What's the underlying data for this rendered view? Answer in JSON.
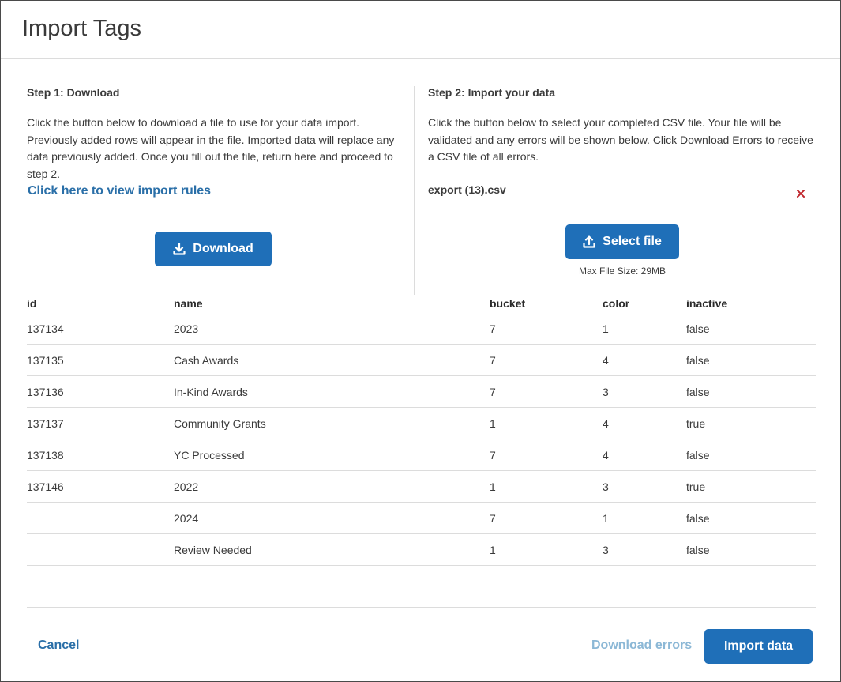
{
  "dialog": {
    "title": "Import Tags"
  },
  "step1": {
    "title": "Step 1: Download",
    "description": "Click the button below to download a file to use for your data import. Previously added rows will appear in the file. Imported data will replace any data previously added. Once you fill out the file, return here and proceed to step 2.",
    "rules_link": "Click here to view import rules",
    "download_label": "Download",
    "download_icon": "download-icon"
  },
  "step2": {
    "title": "Step 2: Import your data",
    "description": "Click the button below to select your completed CSV file. Your file will be validated and any errors will be shown below. Click Download Errors to receive a CSV file of all errors.",
    "file_name": "export (13).csv",
    "remove_icon": "close-icon",
    "select_label": "Select file",
    "select_icon": "upload-icon",
    "max_size": "Max File Size: 29MB"
  },
  "table": {
    "columns": [
      "id",
      "name",
      "bucket",
      "color",
      "inactive"
    ],
    "rows": [
      {
        "id": "137134",
        "name": "2023",
        "bucket": "7",
        "color": "1",
        "inactive": "false"
      },
      {
        "id": "137135",
        "name": "Cash Awards",
        "bucket": "7",
        "color": "4",
        "inactive": "false"
      },
      {
        "id": "137136",
        "name": "In-Kind Awards",
        "bucket": "7",
        "color": "3",
        "inactive": "false"
      },
      {
        "id": "137137",
        "name": "Community Grants",
        "bucket": "1",
        "color": "4",
        "inactive": "true"
      },
      {
        "id": "137138",
        "name": "YC Processed",
        "bucket": "7",
        "color": "4",
        "inactive": "false"
      },
      {
        "id": "137146",
        "name": "2022",
        "bucket": "1",
        "color": "3",
        "inactive": "true"
      },
      {
        "id": "",
        "name": "2024",
        "bucket": "7",
        "color": "1",
        "inactive": "false"
      },
      {
        "id": "",
        "name": "Review Needed",
        "bucket": "1",
        "color": "3",
        "inactive": "false"
      }
    ]
  },
  "footer": {
    "cancel_label": "Cancel",
    "download_errors_label": "Download errors",
    "import_label": "Import data"
  },
  "colors": {
    "primary": "#1f6fb8",
    "link": "#2a6fa8",
    "link_disabled": "#8cb8d6",
    "danger": "#c0272d"
  }
}
